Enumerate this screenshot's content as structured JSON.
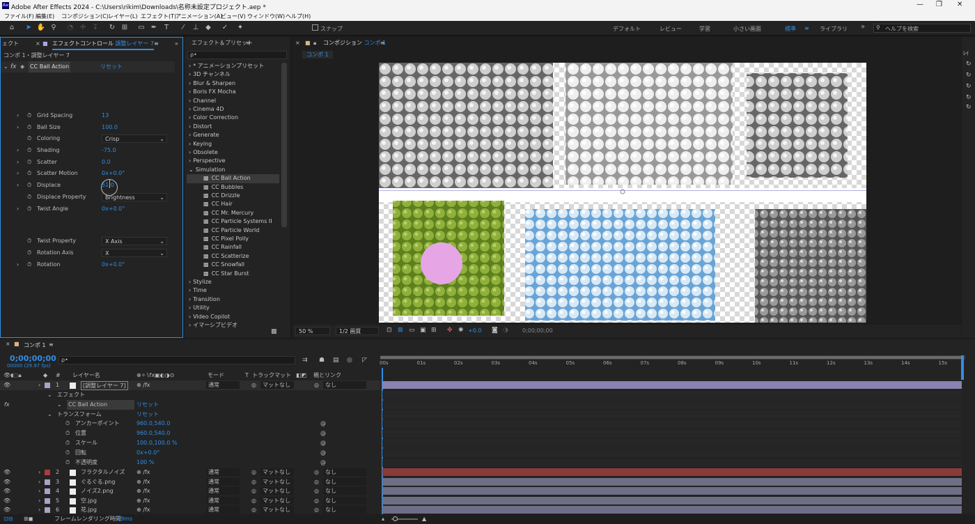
{
  "window": {
    "title": "Adobe After Effects 2024 - C:\\Users\\rikim\\Downloads\\名称未設定プロジェクト.aep *",
    "logo": "Ae",
    "controls": [
      "minimize-icon",
      "maximize-icon",
      "close-icon"
    ]
  },
  "menu": [
    "ファイル(F)",
    "編集(E)",
    "コンポジション(C)",
    "レイヤー(L)",
    "エフェクト(T)",
    "アニメーション(A)",
    "ビュー(V)",
    "ウィンドウ(W)",
    "ヘルプ(H)"
  ],
  "toolbar": {
    "snap": "スナップ",
    "workspaces": [
      "デフォルト",
      "レビュー",
      "学習",
      "小さい画面",
      "標準",
      "ライブラリ"
    ],
    "active_workspace": "標準",
    "help_placeholder": "ヘルプを検索"
  },
  "effect_controls": {
    "tab_left": "ェクト",
    "tab": "エフェクトコントロール",
    "tab_layer": "調整レイヤー 7",
    "breadcrumb": "コンポ 1・調整レイヤー 7",
    "effect_name": "CC Ball Action",
    "reset": "リセット",
    "params": [
      {
        "name": "Grid Spacing",
        "value": "13",
        "type": "num"
      },
      {
        "name": "Ball Size",
        "value": "100.0",
        "type": "num"
      },
      {
        "name": "Coloring",
        "value": "Crisp",
        "type": "select"
      },
      {
        "name": "Shading",
        "value": "-75.0",
        "type": "num"
      },
      {
        "name": "Scatter",
        "value": "0.0",
        "type": "num"
      },
      {
        "name": "Scatter Motion",
        "value": "0x+0.0°",
        "type": "num"
      },
      {
        "name": "Displace",
        "value": "51.0",
        "type": "num"
      },
      {
        "name": "Displace Property",
        "value": "Brightness",
        "type": "select"
      },
      {
        "name": "Twist Angle",
        "value": "0x+0.0°",
        "type": "num"
      },
      {
        "name": "Twist Property",
        "value": "X Axis",
        "type": "select"
      },
      {
        "name": "Rotation Axis",
        "value": "X",
        "type": "select"
      },
      {
        "name": "Rotation",
        "value": "0x+0.0°",
        "type": "num"
      }
    ]
  },
  "effects_presets": {
    "tab": "エフェクト＆プリセット",
    "search_placeholder": "ρ•",
    "categories": [
      "* アニメーションプリセット",
      "3D チャンネル",
      "Blur & Sharpen",
      "Boris FX Mocha",
      "Channel",
      "Cinema 4D",
      "Color Correction",
      "Distort",
      "Generate",
      "Keying",
      "Obsolete",
      "Perspective",
      "Simulation"
    ],
    "simulation_items": [
      "CC Ball Action",
      "CC Bubbles",
      "CC Drizzle",
      "CC Hair",
      "CC Mr. Mercury",
      "CC Particle Systems II",
      "CC Particle World",
      "CC Pixel Polly",
      "CC Rainfall",
      "CC Scatterize",
      "CC Snowfall",
      "CC Star Burst"
    ],
    "categories_after": [
      "Stylize",
      "Time",
      "Transition",
      "Utility",
      "Video Copilot",
      "イマーシブビデオ"
    ]
  },
  "composition": {
    "tab_prefix": "コンポジション",
    "tab_name": "コンポ 1",
    "subtab": "コンポ 1",
    "zoom": "50 %",
    "resolution": "1/2 画質",
    "exposure": "+0.0",
    "timecode": "0;00;00;00"
  },
  "timeline": {
    "tab": "コンポ 1",
    "timecode": "0;00;00;00",
    "fps": "00000 (29.97 fps)",
    "search_placeholder": "ρ•",
    "headers": {
      "name": "レイヤー名",
      "mode": "モード",
      "t": "T",
      "track_matte": "トラックマット",
      "parent": "親とリンク"
    },
    "ruler": [
      "00s",
      "01s",
      "02s",
      "03s",
      "04s",
      "05s",
      "06s",
      "07s",
      "08s",
      "09s",
      "10s",
      "11s",
      "12s",
      "13s",
      "14s",
      "15s"
    ],
    "layer1": {
      "num": "1",
      "name": "[調整レイヤー 7]",
      "mode": "通常",
      "matte": "マットなし",
      "parent": "なし"
    },
    "effects_group": "エフェクト",
    "effect_item": "CC Ball Action",
    "reset": "リセット",
    "transform_group": "トランスフォーム",
    "transform": [
      {
        "name": "アンカーポイント",
        "value": "960.0,540.0"
      },
      {
        "name": "位置",
        "value": "960.0,540.0"
      },
      {
        "name": "スケール",
        "value": "100.0,100.0 %"
      },
      {
        "name": "回転",
        "value": "0x+0.0°"
      },
      {
        "name": "不透明度",
        "value": "100 %"
      }
    ],
    "layers": [
      {
        "num": "2",
        "name": "フラクタルノイズ",
        "mode": "通常",
        "matte": "マットなし",
        "parent": "なし",
        "color": "#b03a3a"
      },
      {
        "num": "3",
        "name": "ぐるぐる.png",
        "mode": "通常",
        "matte": "マットなし",
        "parent": "なし",
        "color": "#a5a5c8"
      },
      {
        "num": "4",
        "name": "ノイズ2.png",
        "mode": "通常",
        "matte": "マットなし",
        "parent": "なし",
        "color": "#a5a5c8"
      },
      {
        "num": "5",
        "name": "空.jpg",
        "mode": "通常",
        "matte": "マットなし",
        "parent": "なし",
        "color": "#a5a5c8"
      },
      {
        "num": "6",
        "name": "花.jpg",
        "mode": "通常",
        "matte": "マットなし",
        "parent": "なし",
        "color": "#a5a5c8"
      }
    ],
    "render_label": "フレームレンダリング時間",
    "render_time": "19ms"
  }
}
